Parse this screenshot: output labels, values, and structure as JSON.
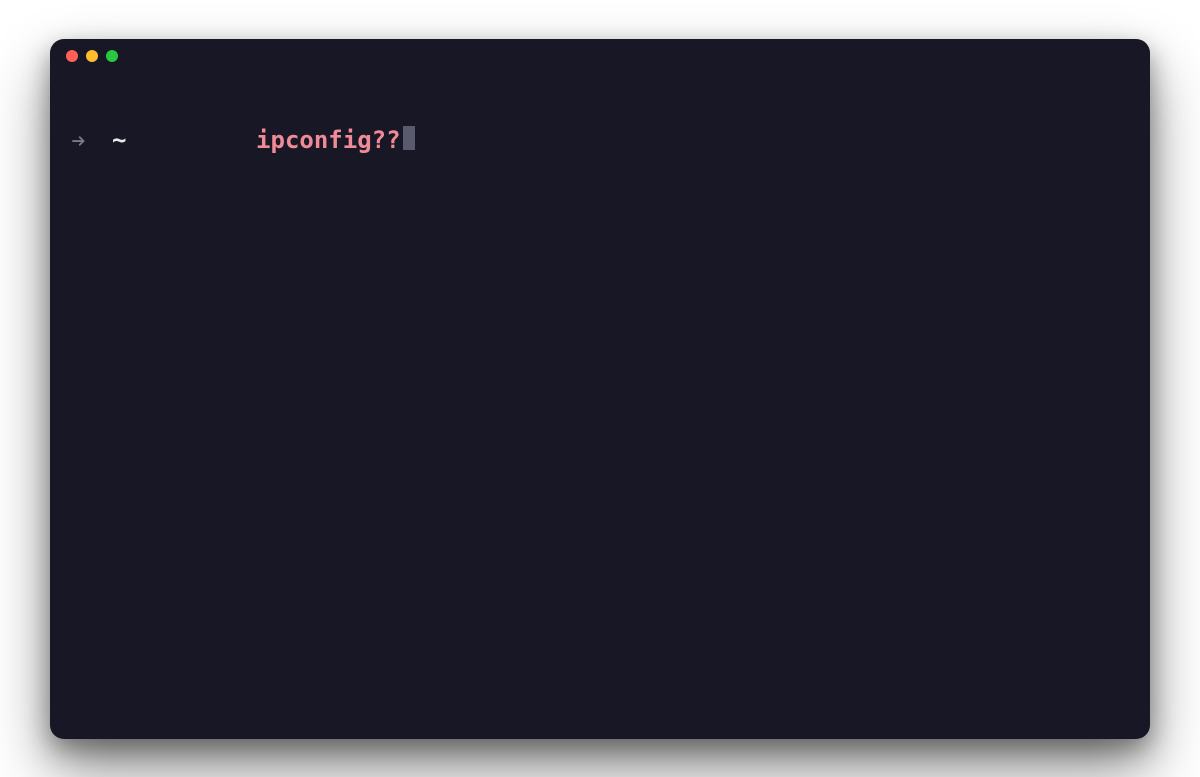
{
  "prompt": {
    "cwd": "~",
    "command": "ipconfig??"
  }
}
